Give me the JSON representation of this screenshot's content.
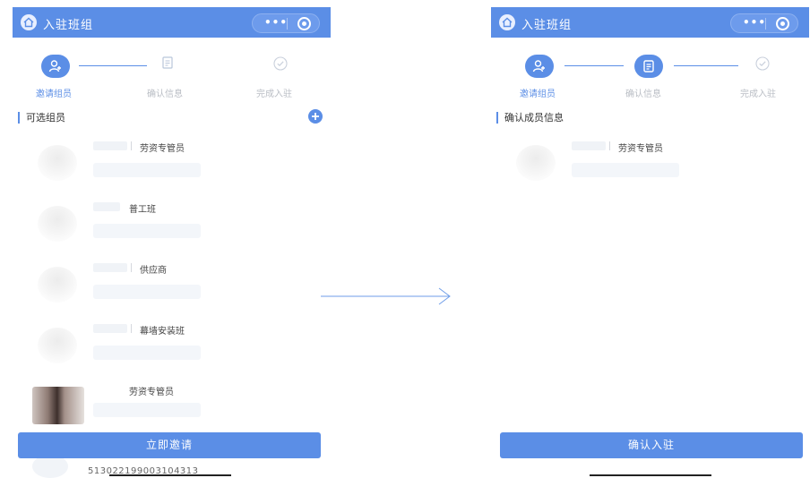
{
  "left_screen": {
    "title": "入驻班组",
    "capsule_more": "•••",
    "steps": [
      {
        "label": "邀请组员",
        "state": "active"
      },
      {
        "label": "确认信息",
        "state": "pending"
      },
      {
        "label": "完成入驻",
        "state": "pending"
      }
    ],
    "section_title": "可选组员",
    "members": [
      {
        "role": "劳资专管员",
        "avatar": "placeholder"
      },
      {
        "role": "普工班",
        "avatar": "placeholder"
      },
      {
        "role": "供应商",
        "avatar": "placeholder"
      },
      {
        "role": "幕墙安装班",
        "avatar": "placeholder"
      },
      {
        "role": "劳资专管员",
        "avatar": "photo"
      }
    ],
    "button_label": "立即邀请",
    "peek_text": "513022199003104313"
  },
  "right_screen": {
    "title": "入驻班组",
    "capsule_more": "•••",
    "steps": [
      {
        "label": "邀请组员",
        "state": "done"
      },
      {
        "label": "确认信息",
        "state": "active"
      },
      {
        "label": "完成入驻",
        "state": "pending"
      }
    ],
    "section_title": "确认成员信息",
    "members": [
      {
        "role": "劳资专管员",
        "avatar": "placeholder"
      }
    ],
    "button_label": "确认入驻"
  },
  "colors": {
    "primary": "#5b8ee6",
    "muted": "#b9bdc4",
    "background": "#ffffff"
  },
  "icons": [
    "home-icon",
    "more-icon",
    "target-icon",
    "user-add-icon",
    "document-icon",
    "check-circle-icon",
    "add-icon",
    "arrow-right-icon"
  ]
}
